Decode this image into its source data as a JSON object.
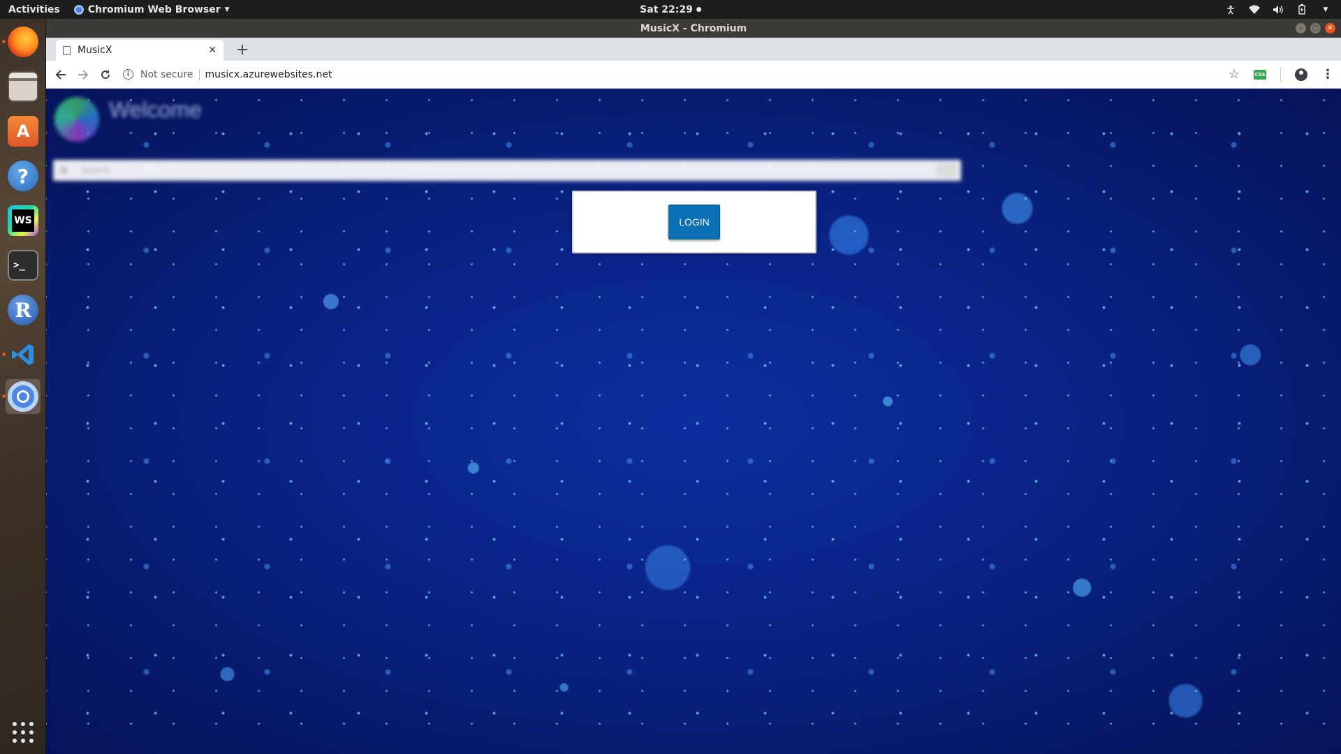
{
  "topbar": {
    "activities": "Activities",
    "app_name": "Chromium Web Browser",
    "clock": "Sat 22:29"
  },
  "window": {
    "title": "MusicX - Chromium"
  },
  "tabs": [
    {
      "title": "MusicX"
    }
  ],
  "toolbar": {
    "security_label": "Not secure",
    "url": "musicx.azurewebsites.net",
    "extension_badge": "CSS"
  },
  "page": {
    "welcome_title": "Welcome",
    "search_placeholder": "Search",
    "login_label": "LOGIN"
  },
  "dock": {
    "apps": [
      "firefox",
      "files",
      "ubuntu-software",
      "help",
      "webstorm",
      "terminal",
      "r",
      "vscode",
      "chromium"
    ]
  },
  "colors": {
    "accent_button": "#0a6fb3",
    "page_background": "#0a2488",
    "close_button": "#e95420"
  }
}
